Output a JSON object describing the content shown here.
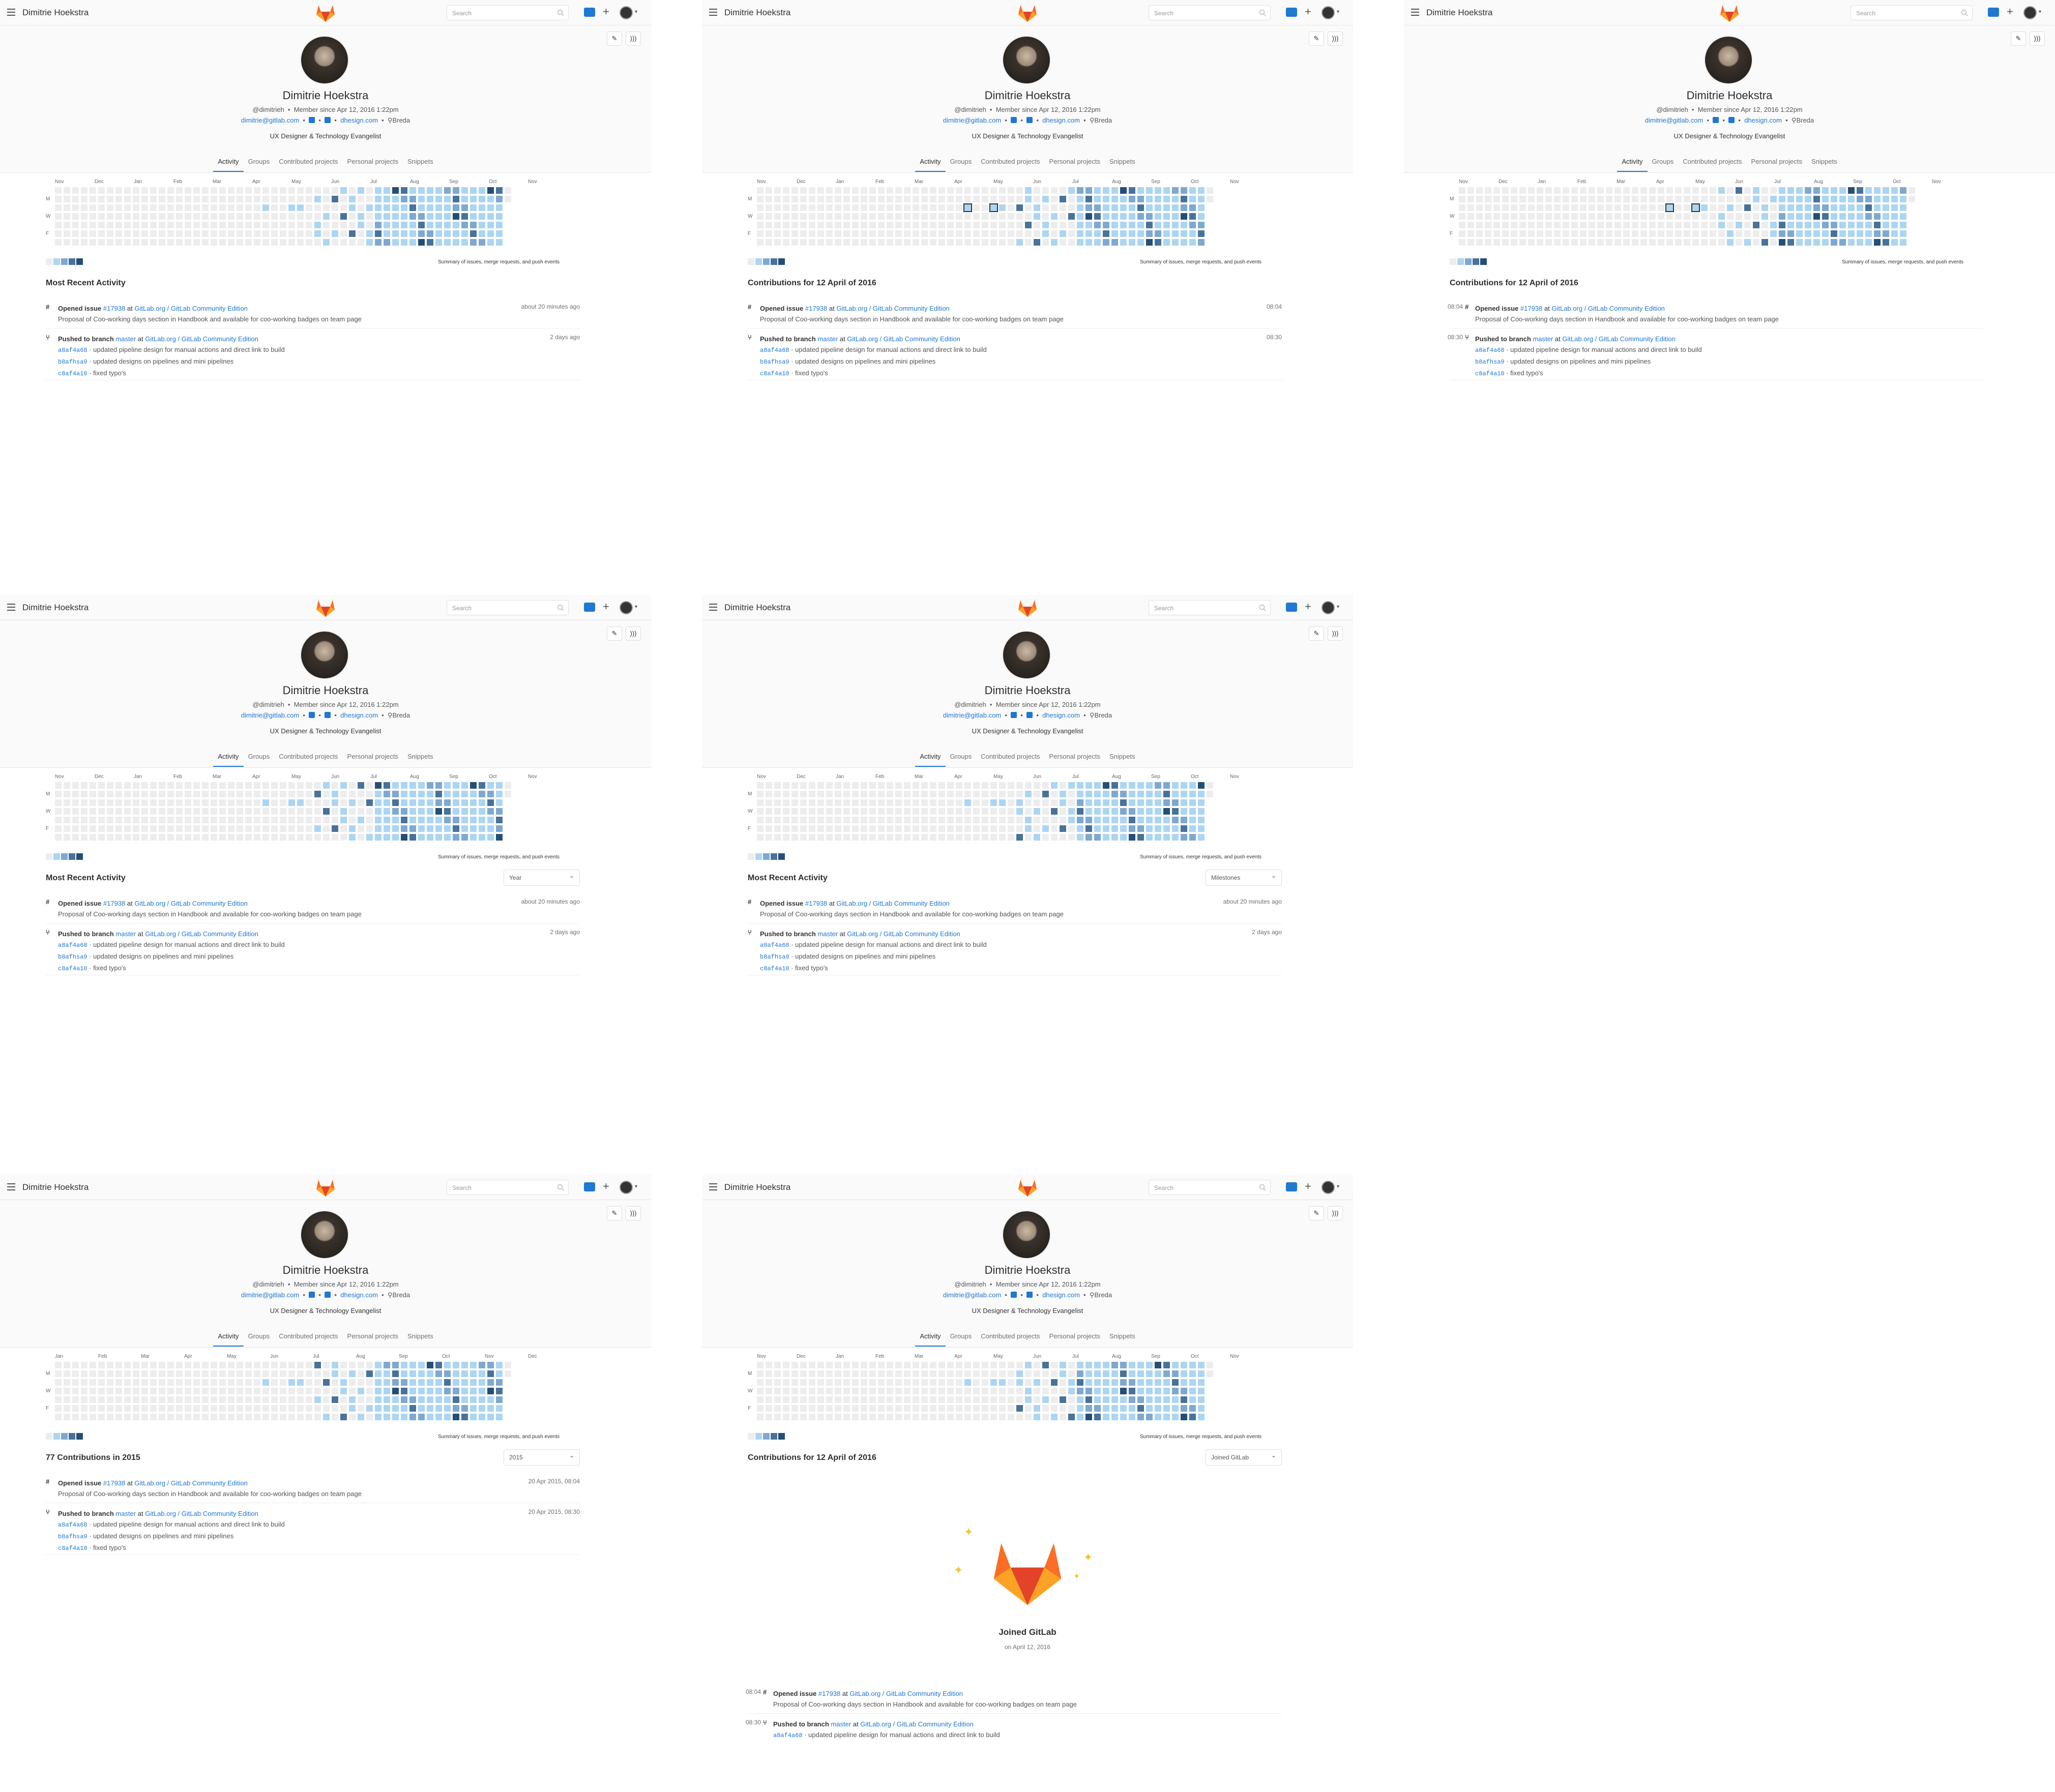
{
  "app": {
    "user_name": "Dimitrie Hoekstra",
    "search_placeholder": "Search"
  },
  "profile": {
    "name": "Dimitrie Hoekstra",
    "username": "@dimitrieh",
    "member_since": "Member since Apr 12, 2016 1:22pm",
    "email": "dimitrie@gitlab.com",
    "website": "dhesign.com",
    "location": "Breda",
    "bio": "UX Designer & Technology Evangelist"
  },
  "tabs": [
    "Activity",
    "Groups",
    "Contributed projects",
    "Personal projects",
    "Snippets"
  ],
  "calendar": {
    "months": [
      "Nov",
      "Dec",
      "Jan",
      "Feb",
      "Mar",
      "Apr",
      "May",
      "Jun",
      "Jul",
      "Aug",
      "Sep",
      "Oct",
      "Nov"
    ],
    "months_2015": [
      "Jan",
      "Feb",
      "Mar",
      "Apr",
      "May",
      "Jun",
      "Jul",
      "Aug",
      "Sep",
      "Oct",
      "Nov",
      "Dec"
    ],
    "days": [
      "M",
      "W",
      "F"
    ],
    "summary": "Summary of issues, merge requests, and push events",
    "colors": [
      "#ededed",
      "#acd5f2",
      "#7fa8d1",
      "#49729b",
      "#254e77"
    ]
  },
  "panels": [
    {
      "title": "Most Recent Activity",
      "filter": "",
      "time1": "about 20 minutes ago",
      "time2": "2 days ago"
    },
    {
      "title": "Contributions for 12 April of 2016",
      "filter": "",
      "time1": "08:04",
      "time2": "08:30"
    },
    {
      "title": "Contributions for 12 April of 2016",
      "filter": "",
      "time1": "08:04",
      "time2": "08:30"
    },
    {
      "title": "Most Recent Activity",
      "filter": "Year",
      "time1": "about 20 minutes ago",
      "time2": "2 days ago"
    },
    {
      "title": "Most Recent Activity",
      "filter": "Milestones",
      "time1": "about 20 minutes ago",
      "time2": "2 days ago"
    },
    {
      "title": "77 Contributions in 2015",
      "filter": "2015",
      "time1": "20 Apr 2015, 08:04",
      "time2": "20 Apr 2015, 08:30"
    },
    {
      "title": "Contributions for 12 April of 2016",
      "filter": "Joined GitLab",
      "time1": "08:04",
      "time2": "08:30"
    }
  ],
  "events": {
    "issue": {
      "prefix": "Opened issue",
      "issue_ref": "#17938",
      "at": "at",
      "project": "GitLab.org / GitLab Community Edition",
      "description": "Proposal of Coo-working days section in Handbook and available for coo-working badges on team page"
    },
    "push": {
      "prefix": "Pushed to branch",
      "branch": "master",
      "at": "at",
      "project": "GitLab.org / GitLab Community Edition",
      "commits": [
        {
          "sha": "a8af4a68",
          "message": "· updated pipeline design for manual actions and direct link to build"
        },
        {
          "sha": "b8afhsa9",
          "message": "· updated designs on pipelines and mini pipelines"
        },
        {
          "sha": "c8af4a10",
          "message": "· fixed typo's"
        }
      ]
    }
  },
  "joined": {
    "title": "Joined GitLab",
    "date": "on April 12, 2016"
  }
}
